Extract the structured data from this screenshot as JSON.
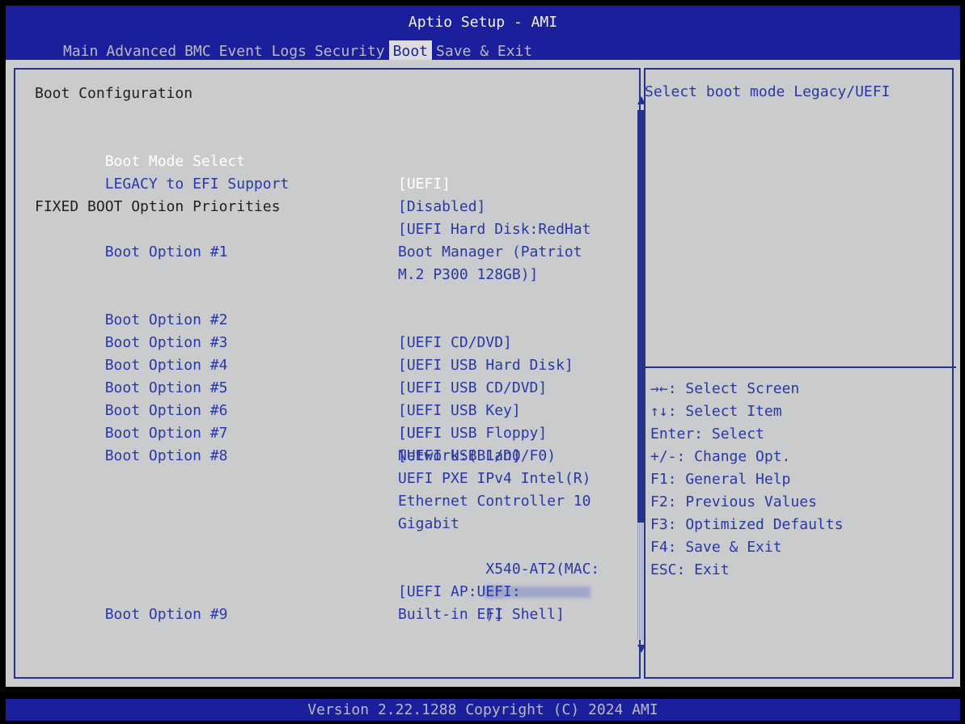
{
  "header": {
    "title": "Aptio Setup - AMI",
    "tabs": [
      {
        "label": "Main"
      },
      {
        "label": "Advanced"
      },
      {
        "label": "BMC"
      },
      {
        "label": "Event Logs"
      },
      {
        "label": "Security"
      },
      {
        "label": "Boot"
      },
      {
        "label": "Save & Exit"
      }
    ]
  },
  "boot": {
    "section_title": "Boot Configuration",
    "boot_mode_label": "Boot Mode Select",
    "boot_mode_value": "[UEFI]",
    "legacy_label": "LEGACY to EFI Support",
    "legacy_value": "[Disabled]",
    "priorities_title": "FIXED BOOT Option Priorities",
    "options": [
      {
        "label": "Boot Option #1",
        "lines": [
          "[UEFI Hard Disk:RedHat",
          "Boot Manager (Patriot",
          "M.2 P300 128GB)]"
        ]
      },
      {
        "label": "Boot Option #2",
        "lines": [
          "[UEFI CD/DVD]"
        ]
      },
      {
        "label": "Boot Option #3",
        "lines": [
          "[UEFI USB Hard Disk]"
        ]
      },
      {
        "label": "Boot Option #4",
        "lines": [
          "[UEFI USB CD/DVD]"
        ]
      },
      {
        "label": "Boot Option #5",
        "lines": [
          "[UEFI USB Key]"
        ]
      },
      {
        "label": "Boot Option #6",
        "lines": [
          "[UEFI USB Floppy]"
        ]
      },
      {
        "label": "Boot Option #7",
        "lines": [
          "[UEFI USB Lan]"
        ]
      },
      {
        "label": "Boot Option #8",
        "lines": [
          "[UEFI",
          "Network:(B1/D0/F0)",
          "UEFI PXE IPv4 Intel(R)",
          "Ethernet Controller 10",
          "Gigabit",
          "X540-AT2(MAC:",
          ")]"
        ]
      },
      {
        "label": "Boot Option #9",
        "lines": [
          "[UEFI AP:UEFI:",
          "Built-in EFI Shell]"
        ]
      }
    ]
  },
  "help": {
    "description": "Select boot mode Legacy/UEFI",
    "keys": [
      {
        "key": "→←",
        "text": ": Select Screen"
      },
      {
        "key": "↑↓",
        "text": ": Select Item"
      },
      {
        "key": "",
        "text": "Enter: Select"
      },
      {
        "key": "",
        "text": "+/-: Change Opt."
      },
      {
        "key": "",
        "text": "F1: General Help"
      },
      {
        "key": "",
        "text": "F2: Previous Values"
      },
      {
        "key": "",
        "text": "F3: Optimized Defaults"
      },
      {
        "key": "",
        "text": "F4: Save & Exit"
      },
      {
        "key": "",
        "text": "ESC: Exit"
      }
    ]
  },
  "footer": {
    "version": "Version 2.22.1288 Copyright (C) 2024 AMI"
  }
}
